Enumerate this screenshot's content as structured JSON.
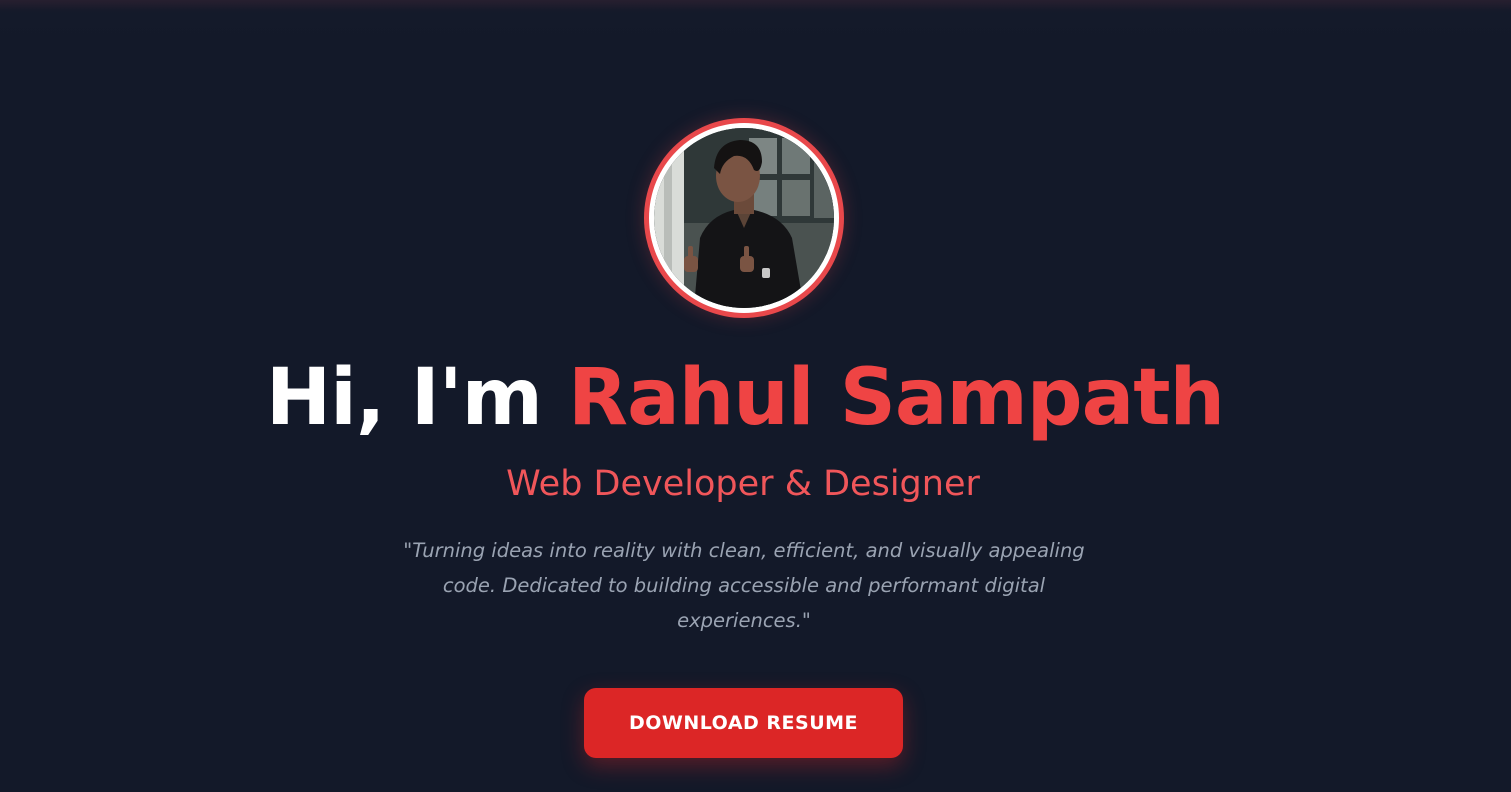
{
  "hero": {
    "greeting": "Hi, I'm",
    "name": "Rahul Sampath",
    "role": "Web Developer & Designer",
    "quote": "\"Turning ideas into reality with clean, efficient, and visually appealing code. Dedicated to building accessible and performant digital experiences.\"",
    "cta_label": "DOWNLOAD RESUME"
  },
  "colors": {
    "background": "#131929",
    "accent": "#ef4444",
    "button": "#dc2626",
    "quote_text": "#9aa3b2"
  }
}
